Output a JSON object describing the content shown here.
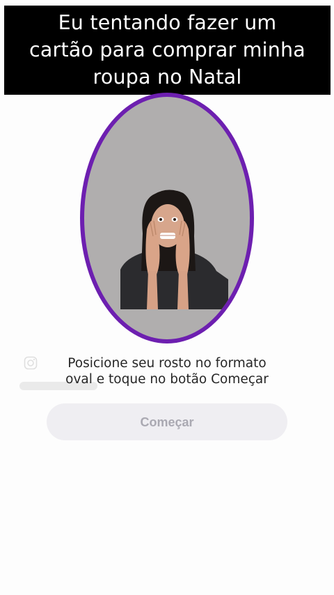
{
  "caption": {
    "line1": "Eu tentando fazer um",
    "line2": "cartão para comprar minha",
    "line3": "roupa no Natal"
  },
  "face_capture": {
    "instruction_line1": "Posicione seu rosto no formato",
    "instruction_line2": "oval e toque no botão Começar",
    "start_label": "Começar",
    "oval_color": "#6d1fb0",
    "button_bg": "#efeef2",
    "button_text_color": "#aaa9b2"
  },
  "watermark": {
    "icon": "instagram-icon"
  }
}
